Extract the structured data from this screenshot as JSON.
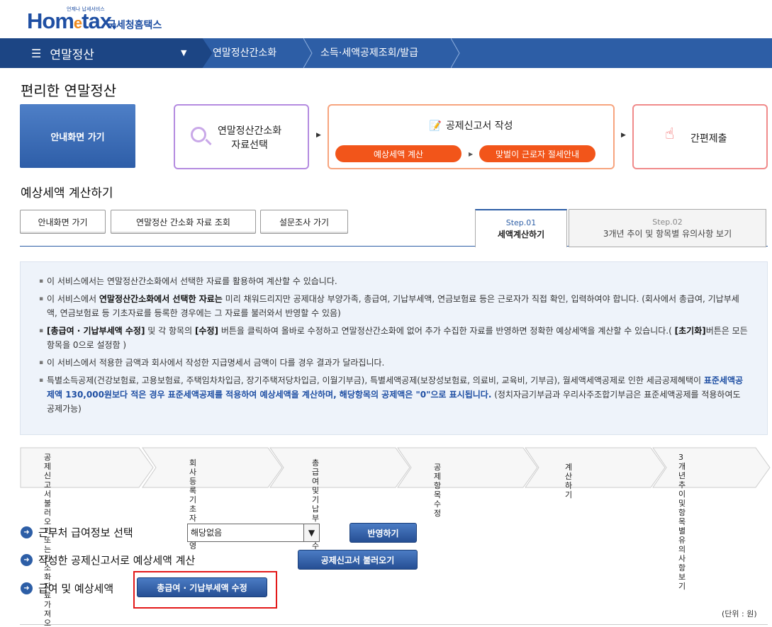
{
  "logo": {
    "brand": "Hometax.",
    "tagline": "언제나 납세서비스",
    "korean": "국세청홈택스"
  },
  "nav": {
    "menu_title": "연말정산",
    "crumb1": "연말정산간소화",
    "crumb2": "소득·세액공제조회/발급"
  },
  "page_title": "편리한 연말정산",
  "steps": {
    "guide": "안내화면 가기",
    "step1": "연말정산간소화\n자료선택",
    "step2": "공제신고서 작성",
    "step2_a": "예상세액 계산",
    "step2_b": "맞벌이 근로자 절세안내",
    "step3": "간편제출"
  },
  "section_title": "예상세액 계산하기",
  "buttons": {
    "guide": "안내화면 가기",
    "lookup": "연말정산 간소화 자료 조회",
    "survey": "설문조사 가기"
  },
  "tabs": [
    {
      "step": "Step.01",
      "label": "세액계산하기"
    },
    {
      "step": "Step.02",
      "label": "3개년 추이 및 항목별 유의사항 보기"
    }
  ],
  "info": {
    "l1": "이 서비스에서는 연말정산간소화에서 선택한 자료를 활용하여 계산할 수 있습니다.",
    "l2a": "이 서비스에서 ",
    "l2b": "연말정산간소화에서 선택한 자료는",
    "l2c": " 미리 채워드리지만 공제대상 부양가족, 총급여, 기납부세액, 연금보험료 등은 근로자가 직접 확인, 입력하여야 합니다. (회사에서 총급여, 기납부세액, 연금보험료 등 기초자료를 등록한 경우에는 그 자료를 불러와서 반영할 수 있음)",
    "l3a": "[총급여 · 기납부세액 수정]",
    "l3b": " 및 각 항목의 ",
    "l3c": "[수정]",
    "l3d": " 버튼을 클릭하여 올바로 수정하고 연말정산간소화에 없어 추가 수집한 자료를 반영하면 정확한 예상세액을 계산할 수 있습니다.( ",
    "l3e": "[초기화]",
    "l3f": "버튼은 모든 항목을 0으로 설정함 )",
    "l4": "이 서비스에서 적용한 금액과 회사에서 작성한 지급명세서 금액이 다를 경우 결과가 달라집니다.",
    "l5a": "특별소득공제(건강보험료, 고용보험료, 주택임차차입금, 장기주택저당차입금, 이월기부금), 특별세액공제(보장성보험료, 의료비, 교육비, 기부금), 월세액세액공제로 인한 세금공제혜택이 ",
    "l5b": "표준세액공제액 130,000원보다 적은 경우 표준세액공제를 적용하여 예상세액을 계산하며, 해당항목의 공제액은 \"0\"으로 표시됩니다.",
    "l5c": " (정치자금기부금과 우리사주조합기부금은 표준세액공제를 적용하여도 공제가능)"
  },
  "flow": [
    "공제신고서 불러오기\n또는\n간소화자료 가져오기",
    "회사등록\n기초자료반영",
    "총급여 및\n기납부세액 수정",
    "공제항목수정",
    "계산하기",
    "3개년 추이 및\n항목별\n유의사항보기"
  ],
  "rows": {
    "r1": "근무처 급여정보 선택",
    "r1_select": "해당없음",
    "r1_btn": "반영하기",
    "r2": "작성한 공제신고서로 예상세액 계산",
    "r2_btn": "공제신고서 불러오기",
    "r3": "급여 및 예상세액",
    "r3_btn": "총급여 · 기납부세액 수정"
  },
  "unit": "(단위 : 원)",
  "colors": {
    "nav": "#2d5ea6",
    "nav_dark": "#1c4584",
    "accent": "#f2551a",
    "highlight": "#e31919"
  }
}
